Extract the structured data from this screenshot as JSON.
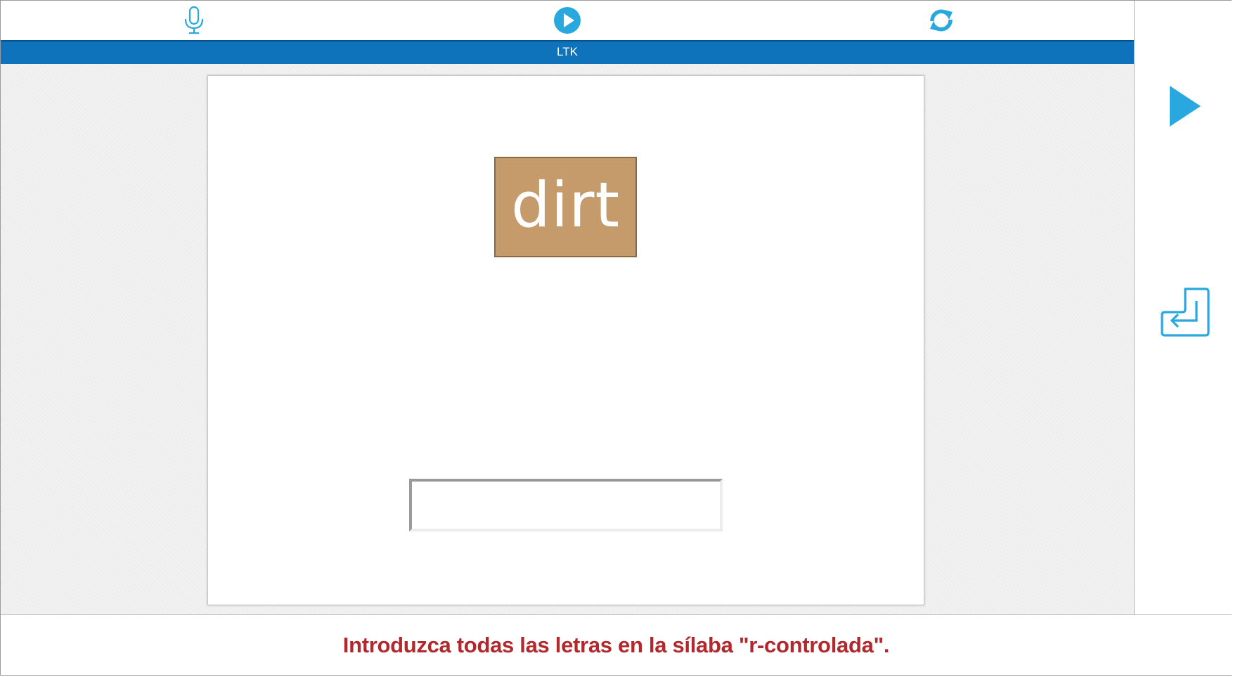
{
  "app": {
    "title": "LTK",
    "accent_color": "#29a8e0",
    "title_bar_color": "#0f73bb"
  },
  "toolbar": {
    "record_icon": "microphone-icon",
    "play_icon": "play-circle-icon",
    "replay_icon": "refresh-icon"
  },
  "side": {
    "next_icon": "play-arrow-icon",
    "enter_icon": "enter-return-icon"
  },
  "exercise": {
    "word": "dirt",
    "tile_color": "#c59b6b",
    "answer_value": "",
    "answer_placeholder": ""
  },
  "footer": {
    "instruction": "Introduzca todas las letras en la sílaba \"r-controlada\".",
    "instruction_color": "#b3282d"
  }
}
